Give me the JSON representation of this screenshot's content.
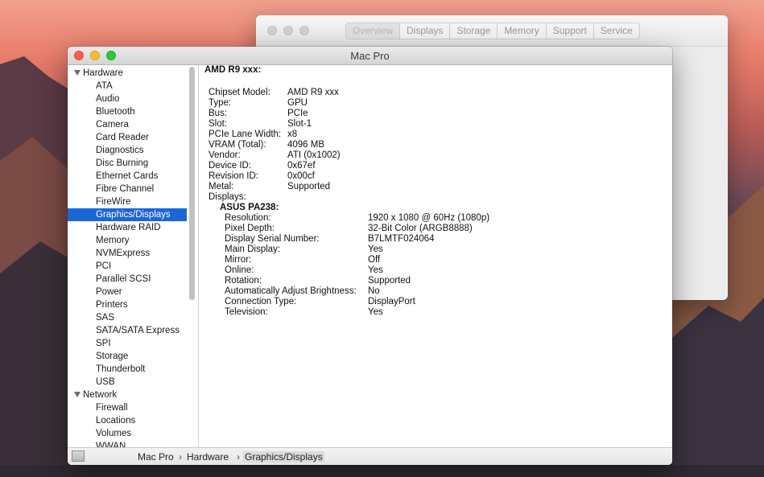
{
  "back_window": {
    "tabs": [
      "Overview",
      "Displays",
      "Storage",
      "Memory",
      "Support",
      "Service"
    ]
  },
  "window": {
    "title": "Mac Pro"
  },
  "sidebar": {
    "groups": [
      {
        "label": "Hardware",
        "items": [
          "ATA",
          "Audio",
          "Bluetooth",
          "Camera",
          "Card Reader",
          "Diagnostics",
          "Disc Burning",
          "Ethernet Cards",
          "Fibre Channel",
          "FireWire",
          "Graphics/Displays",
          "Hardware RAID",
          "Memory",
          "NVMExpress",
          "PCI",
          "Parallel SCSI",
          "Power",
          "Printers",
          "SAS",
          "SATA/SATA Express",
          "SPI",
          "Storage",
          "Thunderbolt",
          "USB"
        ]
      },
      {
        "label": "Network",
        "items": [
          "Firewall",
          "Locations",
          "Volumes",
          "WWAN"
        ]
      }
    ],
    "selected": "Graphics/Displays"
  },
  "content": {
    "header": "AMD R9 xxx:",
    "fields": [
      {
        "k": "Chipset Model:",
        "v": "AMD R9 xxx"
      },
      {
        "k": "Type:",
        "v": "GPU"
      },
      {
        "k": "Bus:",
        "v": "PCIe"
      },
      {
        "k": "Slot:",
        "v": "Slot-1"
      },
      {
        "k": "PCIe Lane Width:",
        "v": "x8"
      },
      {
        "k": "VRAM (Total):",
        "v": "4096 MB"
      },
      {
        "k": "Vendor:",
        "v": "ATI (0x1002)"
      },
      {
        "k": "Device ID:",
        "v": "0x67ef"
      },
      {
        "k": "Revision ID:",
        "v": "0x00cf"
      },
      {
        "k": "Metal:",
        "v": "Supported"
      },
      {
        "k": "Displays:",
        "v": ""
      }
    ],
    "display_name": "ASUS PA238:",
    "display_fields": [
      {
        "k": "Resolution:",
        "v": "1920 x 1080 @ 60Hz (1080p)"
      },
      {
        "k": "Pixel Depth:",
        "v": "32-Bit Color (ARGB8888)"
      },
      {
        "k": "Display Serial Number:",
        "v": "B7LMTF024064"
      },
      {
        "k": "Main Display:",
        "v": "Yes"
      },
      {
        "k": "Mirror:",
        "v": "Off"
      },
      {
        "k": "Online:",
        "v": "Yes"
      },
      {
        "k": "Rotation:",
        "v": "Supported"
      },
      {
        "k": "Automatically Adjust Brightness:",
        "v": "No"
      },
      {
        "k": "Connection Type:",
        "v": "DisplayPort"
      },
      {
        "k": "Television:",
        "v": "Yes"
      }
    ]
  },
  "breadcrumb": {
    "items": [
      "Mac Pro",
      "Hardware",
      "Graphics/Displays"
    ],
    "separator": "›"
  }
}
